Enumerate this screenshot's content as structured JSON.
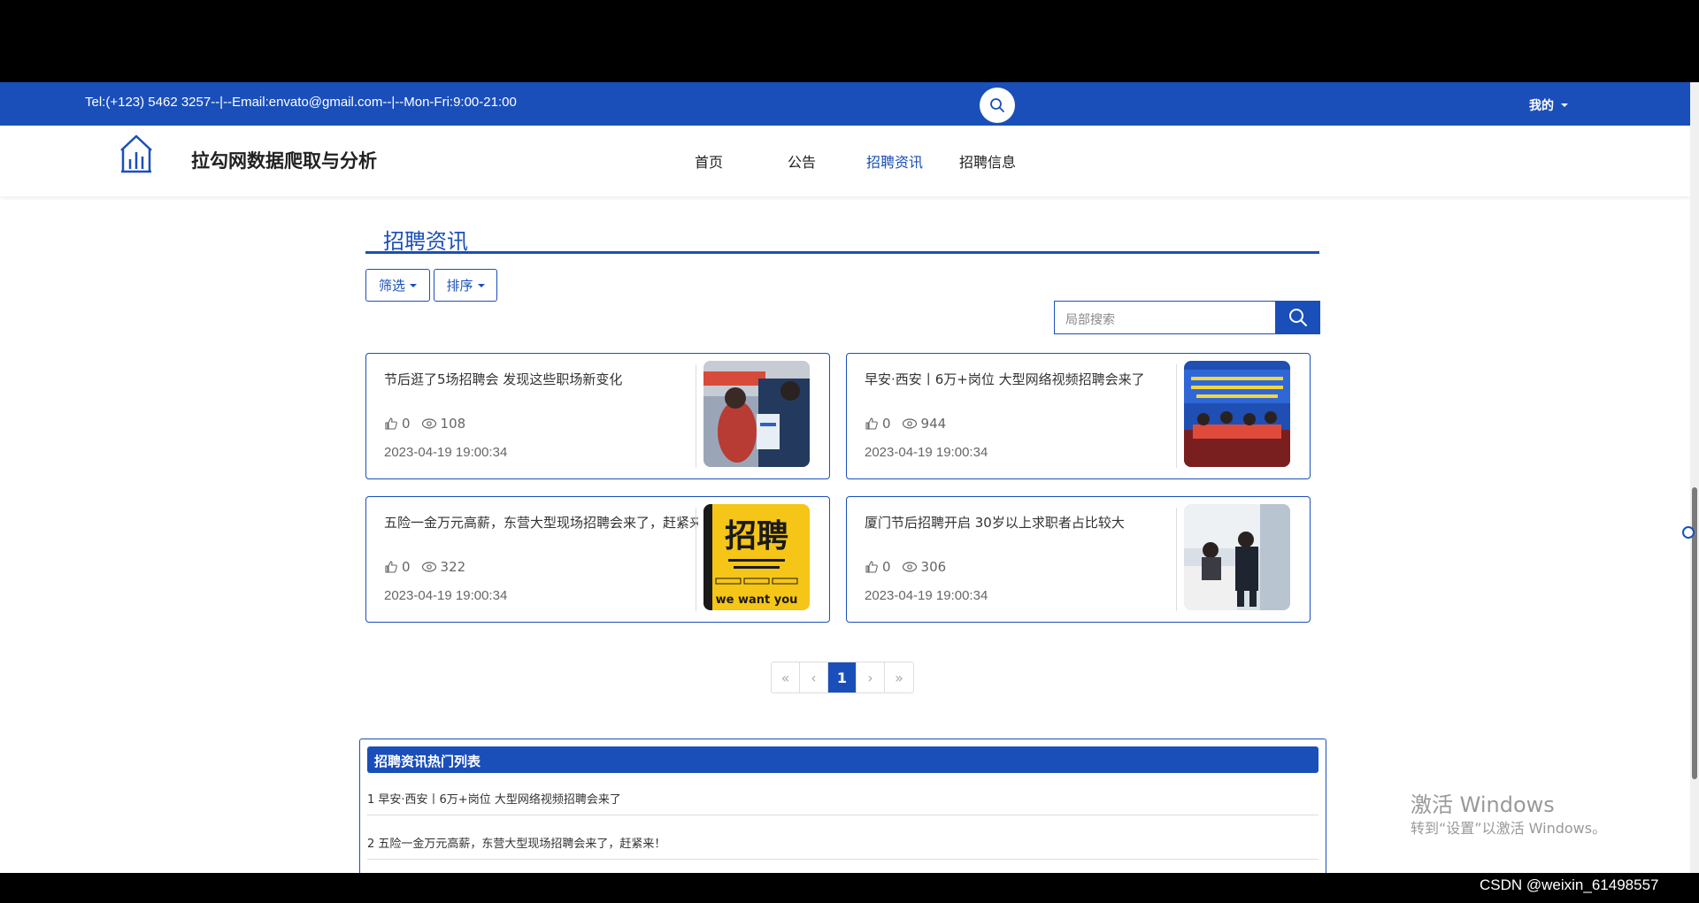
{
  "topbar": {
    "contact": "Tel:(+123) 5462 3257--|--Email:envato@gmail.com--|--Mon-Fri:9:00-21:00",
    "user_menu": "我的"
  },
  "navbar": {
    "site_title": "拉勾网数据爬取与分析",
    "items": [
      {
        "label": "首页",
        "active": false
      },
      {
        "label": "公告",
        "active": false
      },
      {
        "label": "招聘资讯",
        "active": true
      },
      {
        "label": "招聘信息",
        "active": false
      }
    ]
  },
  "section": {
    "title": "招聘资讯",
    "filter_label": "筛选",
    "sort_label": "排序",
    "search_placeholder": "局部搜索"
  },
  "cards": [
    {
      "title": "节后逛了5场招聘会 发现这些职场新变化",
      "likes": "0",
      "views": "108",
      "date": "2023-04-19 19:00:34"
    },
    {
      "title": "早安·西安丨6万+岗位 大型网络视频招聘会来了",
      "likes": "0",
      "views": "944",
      "date": "2023-04-19 19:00:34"
    },
    {
      "title": "五险一金万元高薪，东营大型现场招聘会来了，赶紧来！",
      "likes": "0",
      "views": "322",
      "date": "2023-04-19 19:00:34",
      "img_text": "招聘",
      "img_subtext": "we want you"
    },
    {
      "title": "厦门节后招聘开启 30岁以上求职者占比较大",
      "likes": "0",
      "views": "306",
      "date": "2023-04-19 19:00:34"
    }
  ],
  "pagination": {
    "first": "«",
    "prev": "‹",
    "current": "1",
    "next": "›",
    "last": "»"
  },
  "hot_list": {
    "title": "招聘资讯热门列表",
    "items": [
      "1 早安·西安丨6万+岗位 大型网络视频招聘会来了",
      "2 五险一金万元高薪，东营大型现场招聘会来了，赶紧来！"
    ]
  },
  "watermark": {
    "line1": "激活 Windows",
    "line2": "转到“设置”以激活 Windows。"
  },
  "footer": {
    "csdn": "CSDN @weixin_61498557"
  },
  "colors": {
    "brand": "#1a4fba"
  },
  "icons": [
    "search-icon",
    "chart-logo-icon",
    "thumbs-up-icon",
    "eye-icon",
    "caret-down-icon"
  ]
}
